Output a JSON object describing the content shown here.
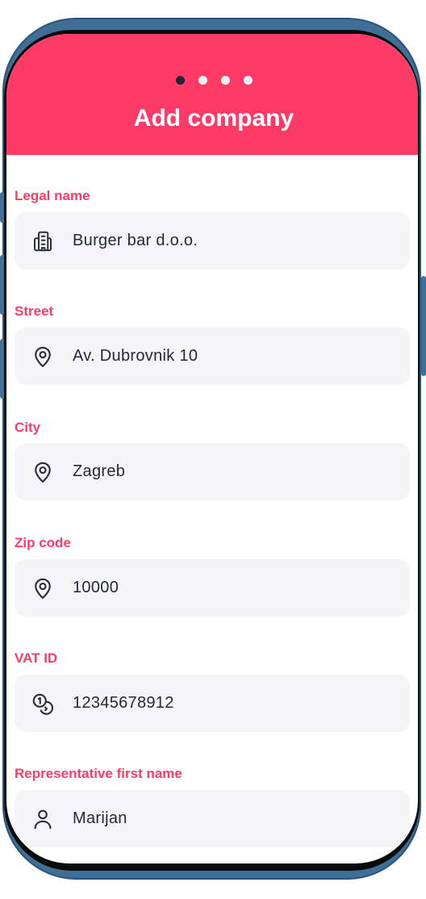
{
  "header": {
    "title": "Add company",
    "steps": [
      true,
      false,
      false,
      false
    ]
  },
  "fields": [
    {
      "label": "Legal name",
      "value": "Burger bar d.o.o.",
      "icon": "building-icon"
    },
    {
      "label": "Street",
      "value": "Av. Dubrovnik 10",
      "icon": "location-pin-icon"
    },
    {
      "label": "City",
      "value": "Zagreb",
      "icon": "location-pin-icon"
    },
    {
      "label": "Zip code",
      "value": "10000",
      "icon": "location-pin-icon"
    },
    {
      "label": "VAT ID",
      "value": "12345678912",
      "icon": "coins-icon"
    },
    {
      "label": "Representative first name",
      "value": "Marijan",
      "icon": "user-icon"
    }
  ],
  "colors": {
    "accent": "#fe3b66",
    "field_bg": "#f5f5f7",
    "text": "#25273a",
    "frame": "#3f6e96"
  }
}
